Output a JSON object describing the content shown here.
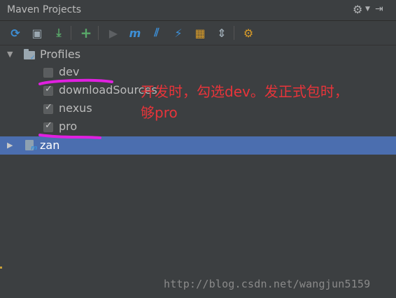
{
  "panel": {
    "title": "Maven Projects",
    "title_icons": [
      "gear-icon",
      "chevron-down-icon",
      "hide-panel-icon"
    ]
  },
  "toolbar": {
    "buttons": [
      {
        "name": "reimport-icon",
        "glyph": "⟳",
        "color": "#3d8fd6"
      },
      {
        "name": "generate-sources-icon",
        "glyph": "▣",
        "color": "#9aa7b0"
      },
      {
        "name": "download-icon",
        "glyph": "⤓",
        "color": "#59a869"
      },
      {
        "name": "add-icon",
        "glyph": "+",
        "color": "#59a869"
      },
      {
        "name": "run-icon",
        "glyph": "▶",
        "color": "#5d6063"
      },
      {
        "name": "execute-goal-icon",
        "glyph": "m",
        "color": "#3d8fd6"
      },
      {
        "name": "toggle-offline-icon",
        "glyph": "⫽",
        "color": "#3d8fd6"
      },
      {
        "name": "skip-tests-icon",
        "glyph": "⚡",
        "color": "#3d8fd6"
      },
      {
        "name": "show-dependencies-icon",
        "glyph": "▦",
        "color": "#d89b28"
      },
      {
        "name": "collapse-all-icon",
        "glyph": "⇕",
        "color": "#9aa7b0"
      },
      {
        "name": "settings-icon",
        "glyph": "⚙",
        "color": "#d89b28"
      }
    ]
  },
  "tree": {
    "profiles_label": "Profiles",
    "profiles": [
      {
        "label": "dev",
        "checked": false
      },
      {
        "label": "downloadSources",
        "checked": true
      },
      {
        "label": "nexus",
        "checked": true
      },
      {
        "label": "pro",
        "checked": true
      }
    ],
    "module_label": "zan"
  },
  "annotation": {
    "line1": "开发时，勾选dev。发正式包时，",
    "line2": "够pro",
    "color": "#e8343a",
    "underline_color": "#e020e0"
  },
  "watermark": "http://blog.csdn.net/wangjun5159",
  "colors": {
    "background": "#3c3f41",
    "selection": "#4b6eaf",
    "text": "#bbbbbb"
  }
}
